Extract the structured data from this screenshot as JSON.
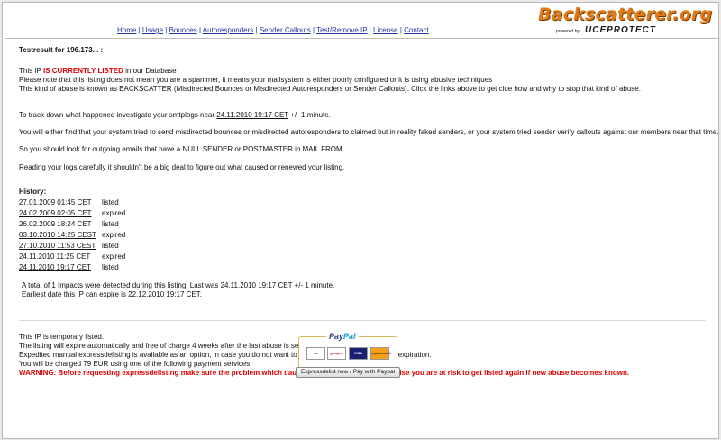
{
  "nav": {
    "links": [
      "Home",
      "Usage",
      "Bounces",
      "Autoresponders",
      "Sender Callouts",
      "Test/Remove IP",
      "License",
      "Contact"
    ],
    "separator": "|"
  },
  "logo": {
    "title": "Backscatterer.org",
    "powered_by": "powered by",
    "brand": "UCEPROTECT"
  },
  "result": {
    "heading": "Testresult for 196.173.   .   :",
    "status_prefix": "This IP ",
    "status_emph": "IS CURRENTLY LISTED",
    "status_suffix": " in our Database",
    "notice1": "Please note that this listing does not mean you are a spammer, it means your mailsystem is either poorly configured or it is using abusive techniques",
    "notice2": "This kind of abuse is known as BACKSCATTER (Misdirected Bounces or Misdirected Autoresponders or Sender Callouts). Click the links above to get clue how and why to stop that kind of abuse.",
    "track_prefix": "To track down what happened investigate your smtplogs near ",
    "track_time": "24.11.2010 19:17 CET",
    "track_suffix": " +/- 1 minute.",
    "find_line": "You will either find that your system tried to send misdirected bounces or misdirected autoresponders to claimed but in reality faked senders, or your system tried sender verify callouts against our members near that time.",
    "look_line": "So you should look for outgoing emails that have a NULL SENDER or POSTMASTER in MAIL FROM.",
    "read_line": "Reading your logs carefully it shouldn't be a big deal to figure out what caused or renewed your listing."
  },
  "history": {
    "heading": "History:",
    "entries": [
      {
        "date": "27.01.2009 01:45 CET",
        "status": "listed"
      },
      {
        "date": "24.02.2009 02:05 CET",
        "status": "expired"
      },
      {
        "date": "26.02.2009 18:24 CET",
        "status": "listed"
      },
      {
        "date": "03.10.2010 14:25 CEST",
        "status": "expired"
      },
      {
        "date": "27.10.2010 11:53 CEST",
        "status": "listed"
      },
      {
        "date": "24.11.2010 11:25 CET",
        "status": "expired"
      },
      {
        "date": "24.11.2010 19:17 CET",
        "status": "listed"
      }
    ],
    "impacts_prefix": "A total of 1 Impacts were detected during this listing. Last was ",
    "impacts_time": "24.11.2010 19:17 CET",
    "impacts_suffix": " +/- 1 minute.",
    "expire_prefix": "Earliest date this IP can expire is ",
    "expire_date": "22.12.2010 19:17 CET",
    "expire_suffix": "."
  },
  "expiry": {
    "line1": "This IP is temporary listed.",
    "line2": "The listing will expire automatically and free of charge 4 weeks after the last abuse is seen from that IP.",
    "line3": "Expedited manual expressdelisting is available as an option, in case you do not want to wait for the automatic and free expiration.",
    "line4": "You will be charged 79 EUR using one of the following payment services.",
    "warning": "WARNING: Before requesting expressdelisting make sure the problem which caused the listing is fixed, otherwise you are at risk to get listed again if new abuse becomes known."
  },
  "payment": {
    "paypal_label_1": "Pay",
    "paypal_label_2": "Pal",
    "cards": [
      "ec",
      "giropay",
      "VISA",
      "mastercard"
    ],
    "button_label": "Expressdelist now / Pay with Paypal"
  }
}
